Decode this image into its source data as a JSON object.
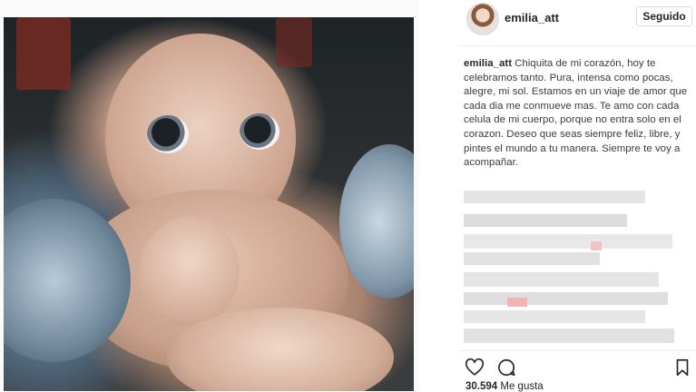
{
  "post": {
    "username": "emilia_att",
    "follow_label": "Seguido",
    "caption_user": "emilia_att",
    "caption_text": "Chiquita de mi corazón, hoy te celebramos tanto. Pura, intensa como pocas, alegre, mi sol. Estamos en un viaje de amor que cada dia me conmueve mas. Te amo con cada celula de mi cuerpo, porque no entra solo en el corazon. Deseo que seas siempre feliz, libre, y pintes el mundo a tu manera. Siempre te voy a acompañar.",
    "likes_count": "30.594",
    "likes_label": "Me gusta"
  },
  "icons": {
    "like": "heart-icon",
    "comment": "comment-icon",
    "save": "bookmark-icon"
  },
  "colors": {
    "text": "#262626",
    "border": "#dbdbdb"
  }
}
